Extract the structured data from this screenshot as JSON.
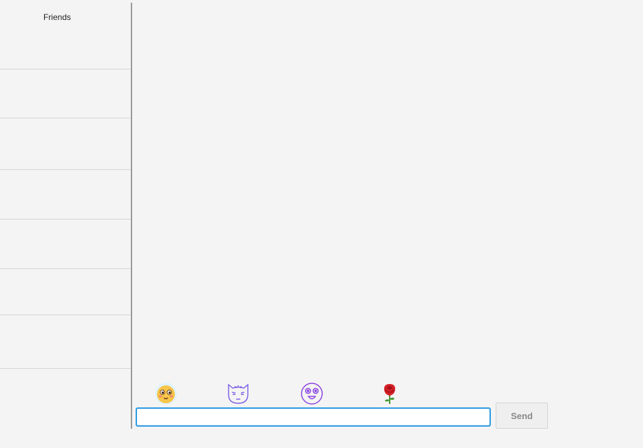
{
  "sidebar": {
    "title": "Friends",
    "friends": [
      "",
      "",
      "",
      "",
      "",
      "",
      ""
    ]
  },
  "emojis": [
    {
      "name": "blushing-face-icon"
    },
    {
      "name": "devil-cat-face-icon"
    },
    {
      "name": "shocked-face-icon"
    },
    {
      "name": "rose-icon"
    }
  ],
  "composer": {
    "input_value": "",
    "placeholder": "",
    "send_label": "Send"
  },
  "colors": {
    "background": "#f4f4f4",
    "input_focus_border": "#2a9be2",
    "send_text": "#8a8a8a"
  }
}
